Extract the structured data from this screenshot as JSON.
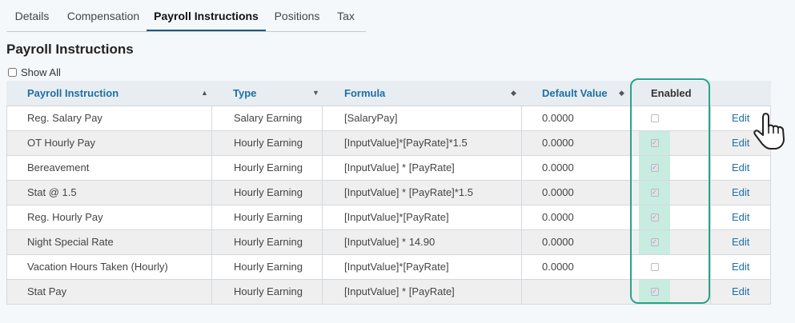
{
  "tabs": [
    {
      "label": "Details",
      "active": false
    },
    {
      "label": "Compensation",
      "active": false
    },
    {
      "label": "Payroll Instructions",
      "active": true
    },
    {
      "label": "Positions",
      "active": false
    },
    {
      "label": "Tax",
      "active": false
    }
  ],
  "section": {
    "title": "Payroll Instructions",
    "show_all_label": "Show All",
    "show_all_checked": false
  },
  "columns": {
    "payroll_instruction": "Payroll Instruction",
    "type": "Type",
    "formula": "Formula",
    "default_value": "Default Value",
    "enabled": "Enabled"
  },
  "icons": {
    "sort": "sort-icon",
    "filter": "dropdown-arrow-icon",
    "cursor": "hand-pointer-icon"
  },
  "colors": {
    "accent": "#1e6fa8",
    "highlight_border": "#2aa38a",
    "enabled_fill": "#c8ece0"
  },
  "rows": [
    {
      "name": "Reg. Salary Pay",
      "type": "Salary Earning",
      "formula": "[SalaryPay]",
      "default_value": "0.0000",
      "enabled": false,
      "action": "Edit"
    },
    {
      "name": "OT Hourly Pay",
      "type": "Hourly Earning",
      "formula": "[InputValue]*[PayRate]*1.5",
      "default_value": "0.0000",
      "enabled": true,
      "action": "Edit"
    },
    {
      "name": "Bereavement",
      "type": "Hourly Earning",
      "formula": "[InputValue] * [PayRate]",
      "default_value": "0.0000",
      "enabled": true,
      "action": "Edit"
    },
    {
      "name": "Stat @ 1.5",
      "type": "Hourly Earning",
      "formula": "[InputValue] * [PayRate]*1.5",
      "default_value": "0.0000",
      "enabled": true,
      "action": "Edit"
    },
    {
      "name": "Reg. Hourly Pay",
      "type": "Hourly Earning",
      "formula": "[InputValue]*[PayRate]",
      "default_value": "0.0000",
      "enabled": true,
      "action": "Edit"
    },
    {
      "name": "Night Special Rate",
      "type": "Hourly Earning",
      "formula": "[InputValue] * 14.90",
      "default_value": "0.0000",
      "enabled": true,
      "action": "Edit"
    },
    {
      "name": "Vacation Hours Taken (Hourly)",
      "type": "Hourly Earning",
      "formula": "[InputValue]*[PayRate]",
      "default_value": "0.0000",
      "enabled": false,
      "action": "Edit"
    },
    {
      "name": "Stat Pay",
      "type": "Hourly Earning",
      "formula": "[InputValue] * [PayRate]",
      "default_value": "",
      "enabled": true,
      "action": "Edit"
    }
  ]
}
